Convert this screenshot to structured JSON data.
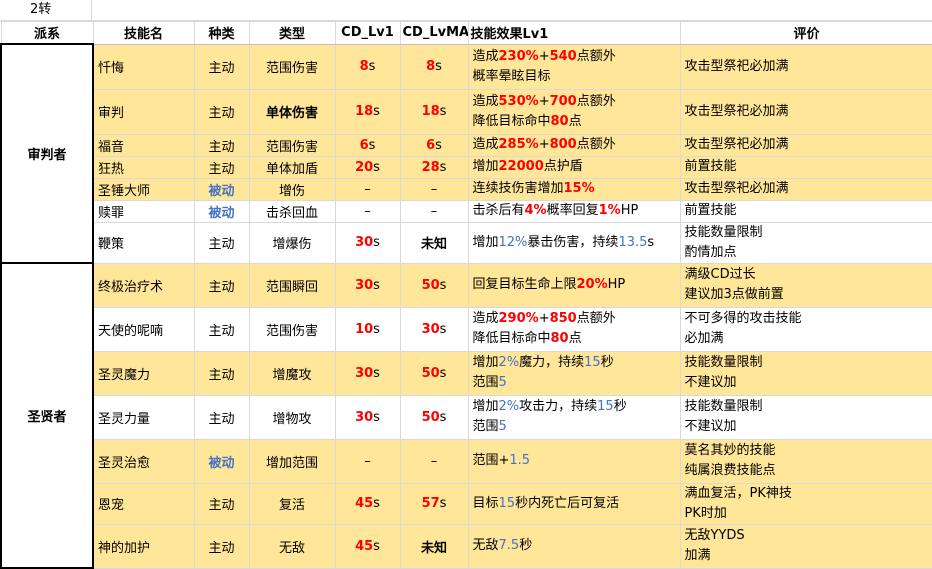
{
  "sheet": {
    "tier_label": "2转",
    "headers": {
      "faction": "派系",
      "skill_name": "技能名",
      "kind": "种类",
      "type": "类型",
      "cd_lv1": "CD_Lv1",
      "cd_lvmax": "CD_LvMAX",
      "effect": "技能效果Lv1",
      "review": "评价"
    },
    "sections": [
      {
        "faction": "审判者",
        "rows": [
          {
            "name": "忏悔",
            "kind": "主动",
            "type": "范围伤害",
            "cd1": "8",
            "cd1_unit": "s",
            "cdmax": "8",
            "cdmax_unit": "s",
            "effect": [
              [
                "造成",
                "230%",
                "+",
                "540",
                "点额外"
              ],
              [
                "概率晕眩目标"
              ]
            ],
            "review": [
              "攻击型祭祀必加满"
            ]
          },
          {
            "name": "审判",
            "kind": "主动",
            "type": "单体伤害",
            "cd1": "18",
            "cd1_unit": "s",
            "cdmax": "18",
            "cdmax_unit": "s",
            "effect": [
              [
                "造成",
                "530%",
                "+",
                "700",
                "点额外"
              ],
              [
                "降低目标命中",
                "80",
                "点"
              ]
            ],
            "review": [
              "攻击型祭祀必加满"
            ]
          },
          {
            "name": "福音",
            "kind": "主动",
            "type": "范围伤害",
            "cd1": "6",
            "cd1_unit": "s",
            "cdmax": "6",
            "cdmax_unit": "s",
            "effect": [
              [
                "造成",
                "285%",
                "+",
                "800",
                "点额外"
              ]
            ],
            "review": [
              "攻击型祭祀必加满"
            ]
          },
          {
            "name": "狂热",
            "kind": "主动",
            "type": "单体加盾",
            "cd1": "20",
            "cd1_unit": "s",
            "cdmax": "28",
            "cdmax_unit": "s",
            "effect": [
              [
                "增加",
                "22000",
                "点护盾"
              ]
            ],
            "review": [
              "前置技能"
            ]
          },
          {
            "name": "圣锤大师",
            "kind": "被动",
            "type": "增伤",
            "cd1": "–",
            "cd1_unit": "",
            "cdmax": "–",
            "cdmax_unit": "",
            "effect": [
              [
                "连续技伤害增加",
                "15%"
              ]
            ],
            "review": [
              "攻击型祭祀必加满"
            ]
          },
          {
            "name": "赎罪",
            "kind": "被动",
            "type": "击杀回血",
            "cd1": "–",
            "cd1_unit": "",
            "cdmax": "–",
            "cdmax_unit": "",
            "effect": [
              [
                "击杀后有",
                "4%",
                "概率回复",
                "1%",
                "HP"
              ]
            ],
            "review": [
              "前置技能"
            ]
          },
          {
            "name": "鞭策",
            "kind": "主动",
            "type": "增爆伤",
            "cd1": "30",
            "cd1_unit": "s",
            "cdmax": "未知",
            "cdmax_unit": "",
            "effect": [
              [
                "增加",
                "12%",
                "暴击伤害，持续",
                "13.5",
                "s"
              ]
            ],
            "review": [
              "技能数量限制",
              "酌情加点"
            ]
          }
        ]
      },
      {
        "faction": "圣贤者",
        "rows": [
          {
            "name": "终极治疗术",
            "kind": "主动",
            "type": "范围瞬回",
            "cd1": "30",
            "cd1_unit": "s",
            "cdmax": "50",
            "cdmax_unit": "s",
            "effect": [
              [
                "回复目标生命上限",
                "20%",
                "HP"
              ]
            ],
            "review": [
              "满级CD过长",
              "建议加3点做前置"
            ]
          },
          {
            "name": "天使的呢喃",
            "kind": "主动",
            "type": "范围伤害",
            "cd1": "10",
            "cd1_unit": "s",
            "cdmax": "30",
            "cdmax_unit": "s",
            "effect": [
              [
                "造成",
                "290%",
                "+",
                "850",
                "点额外"
              ],
              [
                "降低目标命中",
                "80",
                "点"
              ]
            ],
            "review": [
              "不可多得的攻击技能",
              "必加满"
            ]
          },
          {
            "name": "圣灵魔力",
            "kind": "主动",
            "type": "增魔攻",
            "cd1": "30",
            "cd1_unit": "s",
            "cdmax": "50",
            "cdmax_unit": "s",
            "effect": [
              [
                "增加",
                "2%",
                "魔力，持续",
                "15",
                "秒"
              ],
              [
                "范围",
                "5"
              ]
            ],
            "review": [
              "技能数量限制",
              "不建议加"
            ]
          },
          {
            "name": "圣灵力量",
            "kind": "主动",
            "type": "增物攻",
            "cd1": "30",
            "cd1_unit": "s",
            "cdmax": "50",
            "cdmax_unit": "s",
            "effect": [
              [
                "增加",
                "2%",
                "攻击力，持续",
                "15",
                "秒"
              ],
              [
                "范围",
                "5"
              ]
            ],
            "review": [
              "技能数量限制",
              "不建议加"
            ]
          },
          {
            "name": "圣灵治愈",
            "kind": "被动",
            "type": "增加范围",
            "cd1": "–",
            "cd1_unit": "",
            "cdmax": "–",
            "cdmax_unit": "",
            "effect": [
              [
                "范围+",
                "1.5"
              ]
            ],
            "review": [
              "莫名其妙的技能",
              "纯属浪费技能点"
            ]
          },
          {
            "name": "恩宠",
            "kind": "主动",
            "type": "复活",
            "cd1": "45",
            "cd1_unit": "s",
            "cdmax": "57",
            "cdmax_unit": "s",
            "effect": [
              [
                "目标",
                "15",
                "秒内死亡后可复活"
              ]
            ],
            "review": [
              "满血复活，PK神技",
              "PK时加"
            ]
          },
          {
            "name": "神的加护",
            "kind": "主动",
            "type": "无敌",
            "cd1": "45",
            "cd1_unit": "s",
            "cdmax": "未知",
            "cdmax_unit": "",
            "effect": [
              [
                "无敌",
                "7.5",
                "秒"
              ]
            ],
            "review": [
              "无敌YYDS",
              "加满"
            ]
          }
        ]
      }
    ]
  }
}
